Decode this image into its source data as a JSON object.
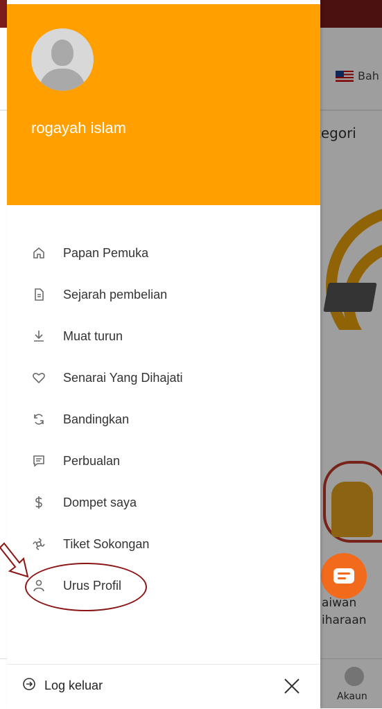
{
  "background": {
    "language_label": "Bah",
    "category_label": "tegori",
    "pet_label_line1": "aiwan",
    "pet_label_line2": "iharaan",
    "account_label": "Akaun"
  },
  "drawer": {
    "header_color": "#ffa000",
    "user_name": "rogayah islam",
    "menu": [
      {
        "label": "Papan Pemuka",
        "icon": "home-icon"
      },
      {
        "label": "Sejarah pembelian",
        "icon": "document-icon"
      },
      {
        "label": "Muat turun",
        "icon": "download-icon"
      },
      {
        "label": "Senarai Yang Dihajati",
        "icon": "heart-icon"
      },
      {
        "label": "Bandingkan",
        "icon": "refresh-icon"
      },
      {
        "label": "Perbualan",
        "icon": "chat-icon"
      },
      {
        "label": "Dompet saya",
        "icon": "dollar-icon"
      },
      {
        "label": "Tiket Sokongan",
        "icon": "support-icon"
      },
      {
        "label": "Urus Profil",
        "icon": "user-icon"
      }
    ],
    "footer": {
      "logout_label": "Log keluar"
    }
  }
}
